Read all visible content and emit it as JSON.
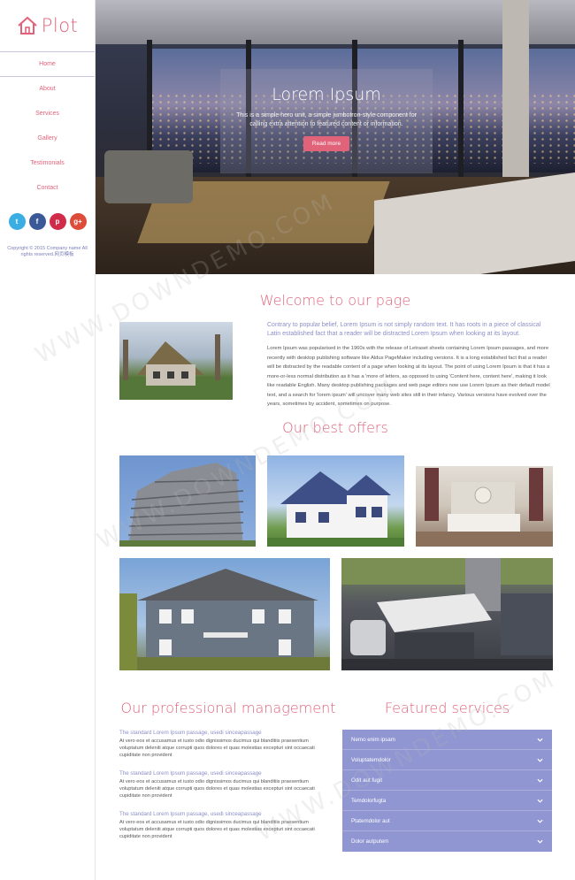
{
  "brand": {
    "name": "Plot",
    "accent": "#e0637a",
    "secondary": "#8f96d2"
  },
  "nav": {
    "items": [
      "Home",
      "About",
      "Services",
      "Gallery",
      "Testimonials",
      "Contact"
    ],
    "active": "Home"
  },
  "social": [
    {
      "icon": "twitter-icon",
      "glyph": "t",
      "color": "#3aaee3"
    },
    {
      "icon": "facebook-icon",
      "glyph": "f",
      "color": "#3b5998"
    },
    {
      "icon": "pinterest-icon",
      "glyph": "p",
      "color": "#d12b4a"
    },
    {
      "icon": "googleplus-icon",
      "glyph": "g+",
      "color": "#dd4b39"
    }
  ],
  "copyright": "Copyright © 2015 Company name All rights reserved.网页模板",
  "hero": {
    "title": "Lorem Ipsum",
    "text": "This is a simple hero unit, a simple jumbotron-style component for calling extra attention to featured content or information.",
    "button": "Read more"
  },
  "welcome": {
    "title": "Welcome to our page",
    "intro": "Contrary to popular belief, Lorem Ipsum is not simply random text. It has roots in a piece of classical Latin established fact that a reader will be distracted Lorem Ipsum when looking at its layout.",
    "body": "Lorem Ipsum was popularised in the 1960s with the release of Letraset sheets containing Lorem Ipsum passages, and more recently with desktop publishing software like Aldus PageMaker including versions. It is a long established fact that a reader will be distracted by the readable content of a page when looking at its layout. The point of using Lorem Ipsum is that it has a more-or-less normal distribution as it has a 'more of letters, as opposed to using 'Content here, content here', making it look like readable English. Many desktop publishing packages and web page editors now use Lorem Ipsum as their default model text, and a search for 'lorem ipsum' will uncover many web sites still in their infancy. Various versions have evolved over the years, sometimes by accident, sometimes on purpose."
  },
  "offers": {
    "title": "Our best offers"
  },
  "management": {
    "title": "Our professional management",
    "items": [
      {
        "heading": "The standard Lorem Ipsum passage, usedi sinceapassage",
        "text": "At vero eos et accusamus et iusto odio dignissimos ducimus qui blanditiis praesentium voluptatum deleniti atque corrupti quos dolores et quas molestias excepturi sint occaecati cupiditate non provident"
      },
      {
        "heading": "The standard Lorem Ipsum passage, usedi sinceapassage",
        "text": "At vero eos et accusamus et iusto odio dignissimos ducimus qui blanditiis praesentium voluptatum deleniti atque corrupti quos dolores et quas molestias excepturi sint occaecati cupiditate non provident"
      },
      {
        "heading": "The standard Lorem Ipsum passage, usedi sinceapassage",
        "text": "At vero eos et accusamus et iusto odio dignissimos ducimus qui blanditiis praesentium voluptatum deleniti atque corrupti quos dolores et quas molestias excepturi sint occaecati cupiditate non provident"
      }
    ]
  },
  "services": {
    "title": "Featured services",
    "items": [
      "Nemo enim ipsam",
      "Voluptatemdolor",
      "Odit aut fugit",
      "Temdolorfugta",
      "Ptatemdolor aut",
      "Dolor autputem"
    ]
  },
  "watermark": "WWW.DOWNDEMO.COM"
}
